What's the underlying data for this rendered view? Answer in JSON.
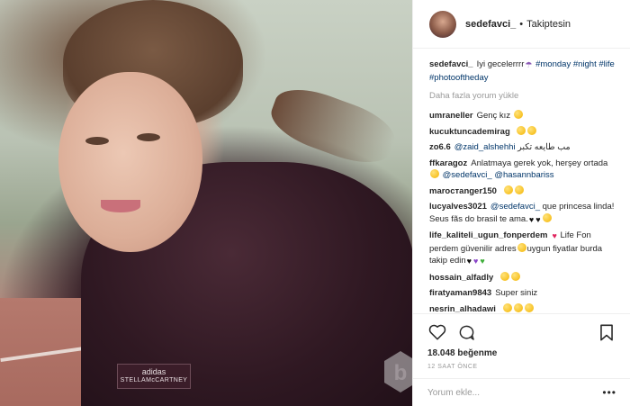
{
  "header": {
    "username": "sedefavci_",
    "separator": "•",
    "follow_status": "Takiptesin"
  },
  "caption": {
    "username": "sedefavci_",
    "text": "Iyi gecelerrrr",
    "tags": [
      "#monday",
      "#night",
      "#life",
      "#photooftheday"
    ]
  },
  "load_more": "Daha fazla yorum yükle",
  "comments": [
    {
      "user": "umraneller",
      "text": "Genç kız"
    },
    {
      "user": "kucuktuncademirag",
      "text": ""
    },
    {
      "user": "zo6.6",
      "mention": "@zaid_alshehhi",
      "text": "مب طايعه تكبر"
    },
    {
      "user": "ffkaragoz",
      "text": "Anlatmaya gerek yok, herşey ortada",
      "mention": "@sedefavci_",
      "mention2": "@hasannbariss"
    },
    {
      "user": "marocтanger150",
      "text": ""
    },
    {
      "user": "lucyalves3021",
      "mention": "@sedefavci_",
      "text": "que princesa linda! Seus fãs do brasil te ama."
    },
    {
      "user": "life_kaliteli_ugun_fonperdem",
      "text": "Life Fon perdem güvenilir adres",
      "text2": "uygun fiyatlar burda",
      "text3": "takip edin"
    },
    {
      "user": "hossain_alfadly",
      "text": ""
    },
    {
      "user": "firatyaman9843",
      "text": "Super siniz"
    },
    {
      "user": "nesrin_alhadawi",
      "text": ""
    }
  ],
  "actions": {
    "like_icon": "heart-icon",
    "comment_icon": "comment-icon",
    "bookmark_icon": "bookmark-icon"
  },
  "likes": "18.048 beğenme",
  "time": "12 SAAT ÖNCE",
  "comment_box": {
    "placeholder": "Yorum ekle...",
    "options": "•••"
  },
  "photo": {
    "brand_logo": "adidas",
    "brand_name": "STELLAMcCARTNEY"
  },
  "colors": {
    "link": "#003569",
    "muted": "#999999",
    "text": "#262626",
    "border": "#efefef"
  }
}
